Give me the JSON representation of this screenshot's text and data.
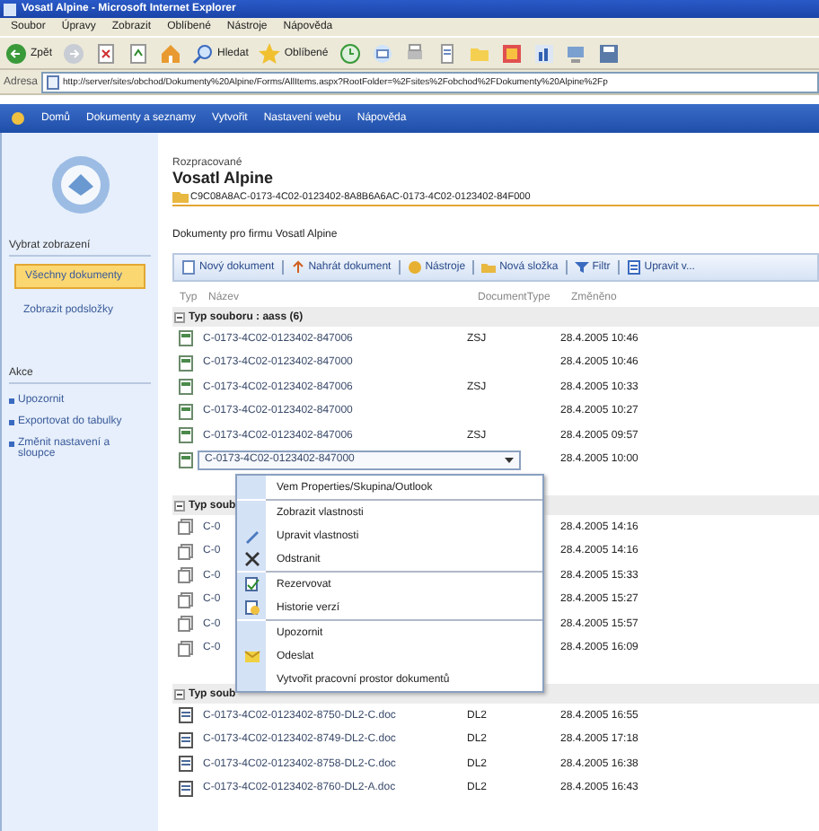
{
  "window": {
    "title": "Vosatl Alpine - Microsoft Internet Explorer"
  },
  "menu_bar": [
    "Soubor",
    "Úpravy",
    "Zobrazit",
    "Oblíbené",
    "Nástroje",
    "Nápověda"
  ],
  "toolbar": [
    {
      "kind": "back",
      "label": "Zpět"
    },
    {
      "kind": "forward"
    },
    {
      "kind": "stop"
    },
    {
      "kind": "refresh"
    },
    {
      "kind": "home"
    },
    {
      "kind": "search",
      "label": "Hledat"
    },
    {
      "kind": "favorites",
      "label": "Oblíbené"
    },
    {
      "kind": "history"
    },
    {
      "kind": "mail"
    },
    {
      "kind": "print"
    },
    {
      "kind": "edit"
    },
    {
      "kind": "folder"
    },
    {
      "kind": "media"
    },
    {
      "kind": "chart"
    },
    {
      "kind": "network"
    },
    {
      "kind": "disk"
    }
  ],
  "address_bar": {
    "label": "Adresa",
    "value": "http://server/sites/obchod/Dokumenty%20Alpine/Forms/AllItems.aspx?RootFolder=%2Fsites%2Fobchod%2FDokumenty%20Alpine%2Fp"
  },
  "site_nav": [
    "Domů",
    "Dokumenty a seznamy",
    "Vytvořit",
    "Nastavení webu",
    "Nápověda"
  ],
  "sidebar": {
    "heading": "Vybrat zobrazení",
    "views": [
      {
        "label": "Všechny dokumenty",
        "selected": true
      },
      {
        "label": "Zobrazit podsložky",
        "selected": false
      }
    ],
    "actions_heading": "Akce",
    "actions": [
      "Upozornit",
      "Exportovat do tabulky",
      "Změnit nastavení a sloupce"
    ]
  },
  "page": {
    "breadcrumb": "Rozpracované",
    "title": "Vosatl Alpine",
    "path": "C9C08A8AC-0173-4C02-0123402-8A8B6A6AC-0173-4C02-0123402-84F000",
    "description": "Dokumenty pro firmu Vosatl Alpine"
  },
  "list_toolbar": [
    {
      "kind": "new",
      "label": "Nový dokument"
    },
    {
      "kind": "upload",
      "label": "Nahrát dokument"
    },
    {
      "kind": "tools",
      "label": "Nástroje"
    },
    {
      "kind": "folder",
      "label": "Nová složka"
    },
    {
      "kind": "filter",
      "label": "Filtr"
    },
    {
      "kind": "edit",
      "label": "Upravit v..."
    }
  ],
  "table": {
    "columns": [
      "Typ",
      "Název",
      "DocumentType",
      "Změněno"
    ],
    "groups": [
      {
        "label": "Typ souboru : aass (6)",
        "expanded": true,
        "kind": "doc",
        "rows": [
          {
            "name": "C-0173-4C02-0123402-847006",
            "type": "ZSJ",
            "modified": "28.4.2005 10:46",
            "selected": false
          },
          {
            "name": "C-0173-4C02-0123402-847000",
            "type": "",
            "modified": "28.4.2005 10:46",
            "selected": false
          },
          {
            "name": "C-0173-4C02-0123402-847006",
            "type": "ZSJ",
            "modified": "28.4.2005 10:33",
            "selected": false
          },
          {
            "name": "C-0173-4C02-0123402-847000",
            "type": "",
            "modified": "28.4.2005 10:27",
            "selected": false
          },
          {
            "name": "C-0173-4C02-0123402-847006",
            "type": "ZSJ",
            "modified": "28.4.2005 09:57",
            "selected": false
          },
          {
            "name": "C-0173-4C02-0123402-847000",
            "type": "",
            "modified": "28.4.2005 10:00",
            "selected": true
          }
        ]
      },
      {
        "label": "Typ soub",
        "expanded": true,
        "kind": "folder",
        "rows": [
          {
            "name": "C-0",
            "type": "",
            "modified": "28.4.2005 14:16",
            "selected": false
          },
          {
            "name": "C-0",
            "type": "",
            "modified": "28.4.2005 14:16",
            "selected": false
          },
          {
            "name": "C-0",
            "type": "",
            "modified": "28.4.2005 15:33",
            "selected": false
          },
          {
            "name": "C-0",
            "type": "",
            "modified": "28.4.2005 15:27",
            "selected": false
          },
          {
            "name": "C-0",
            "type": "",
            "modified": "28.4.2005 15:57",
            "selected": false
          },
          {
            "name": "C-0",
            "type": "",
            "modified": "28.4.2005 16:09",
            "selected": false
          }
        ]
      },
      {
        "label": "Typ soub",
        "expanded": true,
        "kind": "link",
        "rows": [
          {
            "name": "C-0173-4C02-0123402-8750-DL2-C.doc",
            "type": "DL2",
            "modified": "28.4.2005 16:55",
            "selected": false
          },
          {
            "name": "C-0173-4C02-0123402-8749-DL2-C.doc",
            "type": "DL2",
            "modified": "28.4.2005 17:18",
            "selected": false
          },
          {
            "name": "C-0173-4C02-0123402-8758-DL2-C.doc",
            "type": "DL2",
            "modified": "28.4.2005 16:38",
            "selected": false
          },
          {
            "name": "C-0173-4C02-0123402-8760-DL2-A.doc",
            "type": "DL2",
            "modified": "28.4.2005 16:43",
            "selected": false
          }
        ]
      }
    ]
  },
  "context_menu": {
    "items": [
      {
        "label": "Vem Properties/Skupina/Outlook",
        "kind": "plain",
        "separator_before": false
      },
      {
        "label": "Zobrazit vlastnosti",
        "kind": "plain",
        "separator_before": true
      },
      {
        "label": "Upravit vlastnosti",
        "kind": "edit",
        "separator_before": false
      },
      {
        "label": "Odstranit",
        "kind": "delete",
        "separator_before": false
      },
      {
        "label": "Rezervovat",
        "kind": "checkout",
        "separator_before": true
      },
      {
        "label": "Historie verzí",
        "kind": "history",
        "separator_before": false
      },
      {
        "label": "Upozornit",
        "kind": "plain",
        "separator_before": true
      },
      {
        "label": "Odeslat",
        "kind": "send",
        "separator_before": false
      },
      {
        "label": "Vytvořit pracovní prostor dokumentů",
        "kind": "plain",
        "separator_before": false
      }
    ]
  }
}
